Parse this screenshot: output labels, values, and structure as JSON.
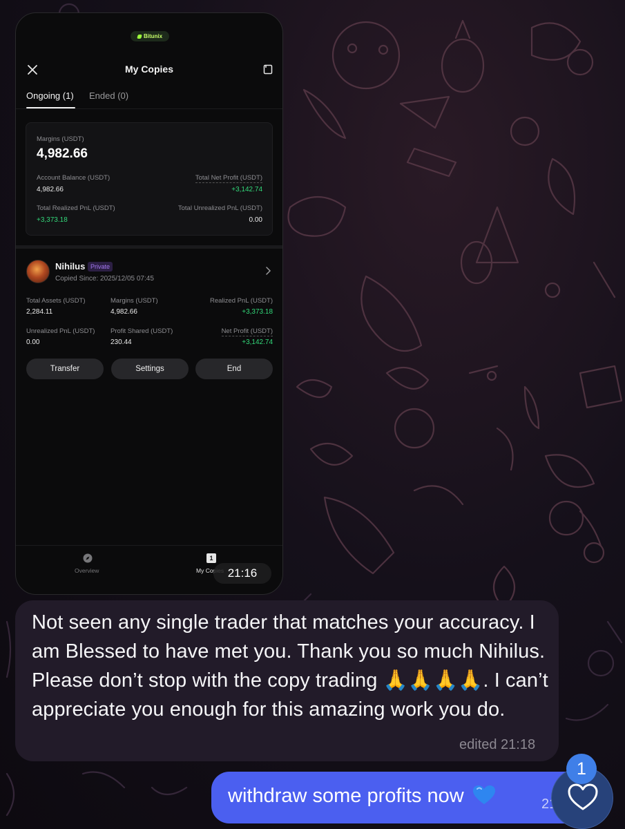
{
  "app": {
    "brand": "Bitunix",
    "title": "My Copies",
    "tabs": [
      {
        "label": "Ongoing (1)",
        "active": true
      },
      {
        "label": "Ended (0)",
        "active": false
      }
    ]
  },
  "summary": {
    "margins_label": "Margins (USDT)",
    "margins_value": "4,982.66",
    "account_balance_label": "Account Balance (USDT)",
    "account_balance_value": "4,982.66",
    "total_net_profit_label": "Total Net Profit (USDT)",
    "total_net_profit_value": "+3,142.74",
    "total_realized_label": "Total Realized PnL (USDT)",
    "total_realized_value": "+3,373.18",
    "total_unrealized_label": "Total Unrealized PnL (USDT)",
    "total_unrealized_value": "0.00"
  },
  "trader": {
    "name": "Nihilus",
    "badge": "Private",
    "copied_since": "Copied Since: 2025/12/05 07:45",
    "stats": {
      "total_assets_label": "Total Assets (USDT)",
      "total_assets_value": "2,284.11",
      "margins_label": "Margins (USDT)",
      "margins_value": "4,982.66",
      "realized_label": "Realized PnL (USDT)",
      "realized_value": "+3,373.18",
      "unrealized_label": "Unrealized PnL (USDT)",
      "unrealized_value": "0.00",
      "profit_shared_label": "Profit Shared (USDT)",
      "profit_shared_value": "230.44",
      "net_profit_label": "Net Profit (USDT)",
      "net_profit_value": "+3,142.74"
    },
    "buttons": {
      "transfer": "Transfer",
      "settings": "Settings",
      "end": "End"
    }
  },
  "bottom_nav": {
    "overview": "Overview",
    "my_copies": "My Copies",
    "my_copies_icon_text": "1"
  },
  "chat": {
    "media_time": "21:16",
    "incoming_text": "Not seen any single trader that matches your accuracy. I am Blessed to have met you. Thank you so much Nihilus. Please don’t stop with the copy trading 🙏🙏🙏🙏. I can’t appreciate you enough for this amazing work you do.",
    "incoming_meta": "edited 21:18",
    "outgoing_text": "withdraw some profits now",
    "outgoing_emoji": "blue-heart-icon",
    "outgoing_time": "21",
    "reaction_count": "1",
    "reaction_icon": "heart-icon"
  },
  "colors": {
    "accent_green": "#33d97a",
    "outgoing_bubble": "#4b5ff0",
    "incoming_bubble": "#221b29",
    "private_badge": "#a478f0"
  }
}
